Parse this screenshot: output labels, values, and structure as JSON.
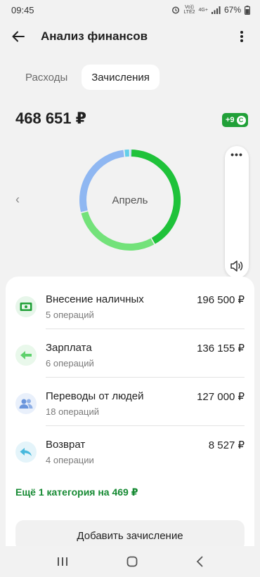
{
  "status": {
    "time": "09:45",
    "network_top": "Vo))",
    "network_bottom": "LTE2",
    "net_type": "4G+",
    "battery": "67%"
  },
  "header": {
    "title": "Анализ финансов"
  },
  "tabs": [
    {
      "label": "Расходы",
      "active": false
    },
    {
      "label": "Зачисления",
      "active": true
    }
  ],
  "summary": {
    "total": "468 651 ₽",
    "bonus_badge": "+9",
    "bonus_coin": "С",
    "month": "Апрель"
  },
  "chart_data": {
    "type": "pie",
    "categories": [
      "Внесение наличных",
      "Зарплата",
      "Переводы от людей",
      "Возврат",
      "Ещё 1 категория"
    ],
    "values": [
      196500,
      136155,
      127000,
      8527,
      469
    ],
    "colors": [
      "#1fc23a",
      "#73e27a",
      "#8fb7f2",
      "#63cfe9",
      "#b9d3f7"
    ]
  },
  "categories": [
    {
      "name": "Внесение наличных",
      "count": "5 операций",
      "amount": "196 500 ₽",
      "icon": "cash-icon",
      "icon_color": "#21a038",
      "icon_bg": "#e7f6ea"
    },
    {
      "name": "Зарплата",
      "count": "6 операций",
      "amount": "136 155 ₽",
      "icon": "arrow-left-icon",
      "icon_color": "#5fd16d",
      "icon_bg": "#e9f8eb"
    },
    {
      "name": "Переводы от людей",
      "count": "18 операций",
      "amount": "127 000 ₽",
      "icon": "people-icon",
      "icon_color": "#6a95dc",
      "icon_bg": "#e9f0fb"
    },
    {
      "name": "Возврат",
      "count": "4 операции",
      "amount": "8 527 ₽",
      "icon": "return-icon",
      "icon_color": "#49b9dd",
      "icon_bg": "#e4f4fa"
    }
  ],
  "more_link": "Ещё 1 категория на 469 ₽",
  "add_button": "Добавить зачисление",
  "volume_menu": "•••"
}
